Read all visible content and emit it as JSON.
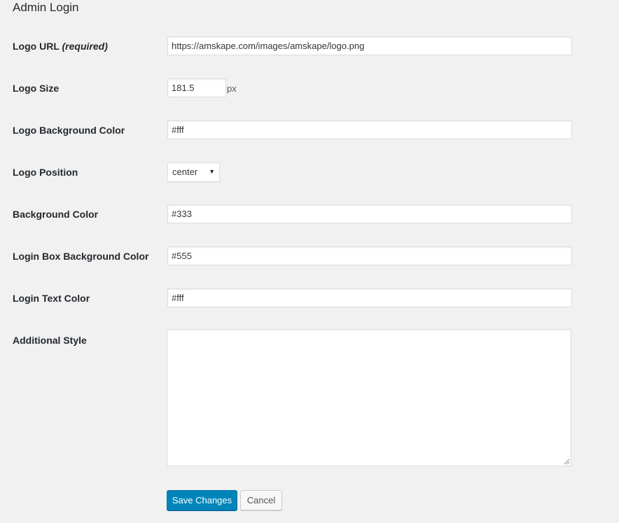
{
  "section": {
    "title": "Admin Login"
  },
  "fields": {
    "logo_url": {
      "label": "Logo URL",
      "required_label": "(required)",
      "value": "https://amskape.com/images/amskape/logo.png"
    },
    "logo_size": {
      "label": "Logo Size",
      "value": "181.5",
      "unit": "px"
    },
    "logo_bg_color": {
      "label": "Logo Background Color",
      "value": "#fff"
    },
    "logo_position": {
      "label": "Logo Position",
      "selected": "center"
    },
    "bg_color": {
      "label": "Background Color",
      "value": "#333"
    },
    "login_box_bg_color": {
      "label": "Login Box Background Color",
      "value": "#555"
    },
    "login_text_color": {
      "label": "Login Text Color",
      "value": "#fff"
    },
    "additional_style": {
      "label": "Additional Style",
      "value": ""
    }
  },
  "actions": {
    "save_label": "Save Changes",
    "cancel_label": "Cancel"
  },
  "colors": {
    "primary_button": "#0085ba",
    "page_background": "#f1f1f1"
  }
}
